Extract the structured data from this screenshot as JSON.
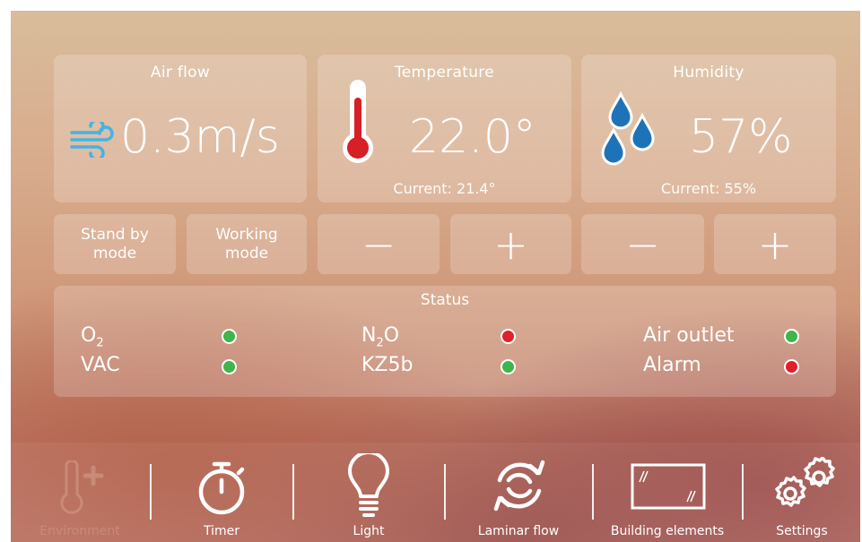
{
  "airflow": {
    "title": "Air flow",
    "value": "0.3m/s",
    "icon": "wind-icon"
  },
  "temperature": {
    "title": "Temperature",
    "value": "22.0°",
    "current": "Current: 21.4°",
    "icon": "thermometer-icon"
  },
  "humidity": {
    "title": "Humidity",
    "value": "57%",
    "current": "Current: 55%",
    "icon": "water-drops-icon"
  },
  "modes": {
    "standby": "Stand by mode",
    "working": "Working mode"
  },
  "adjust": {
    "minus": "−",
    "plus": "+"
  },
  "status": {
    "title": "Status",
    "items": [
      {
        "label_main": "O",
        "label_sub": "2",
        "label_tail": "",
        "state": "green"
      },
      {
        "label_main": "VAC",
        "state": "green"
      },
      {
        "label_main": "N",
        "label_sub": "2",
        "label_tail": "O",
        "state": "red"
      },
      {
        "label_main": "KZ5b",
        "state": "green"
      },
      {
        "label_main": "Air outlet",
        "state": "green"
      },
      {
        "label_main": "Alarm",
        "state": "red"
      }
    ]
  },
  "nav": {
    "environment": "Environment",
    "timer": "Timer",
    "light": "Light",
    "laminar": "Laminar flow",
    "building": "Building elements",
    "settings": "Settings"
  },
  "colors": {
    "accent_blue": "#1e73b8",
    "airflow_icon": "#45b3e3",
    "thermo_red": "#d61f26",
    "status_green": "#3fb54a",
    "status_red": "#e0202a",
    "inactive_nav": "#c98a78"
  }
}
